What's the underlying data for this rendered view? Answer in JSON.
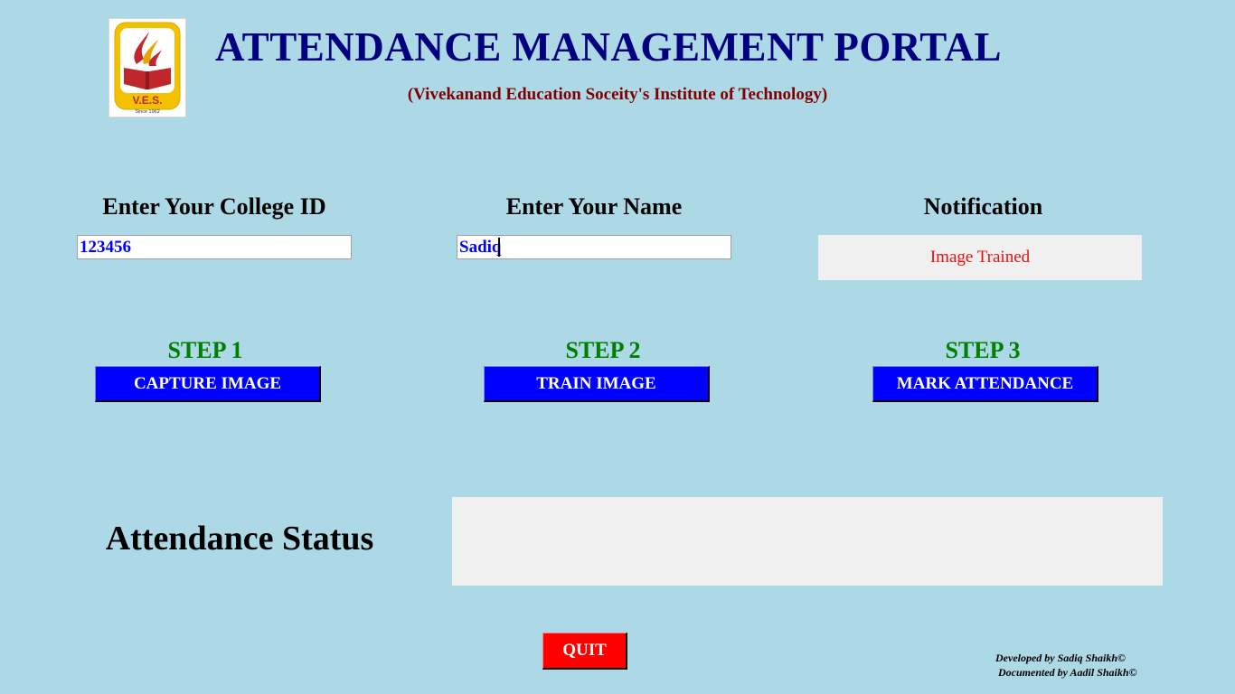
{
  "header": {
    "title": "ATTENDANCE MANAGEMENT PORTAL",
    "subtitle": "(Vivekanand Education Soceity's Institute of Technology)",
    "logo": {
      "icon": "ves-logo",
      "text": "V.E.S.",
      "since": "Since 1962"
    }
  },
  "form": {
    "college_id": {
      "label": "Enter Your College ID",
      "value": "123456"
    },
    "name": {
      "label": "Enter Your Name",
      "value": "Sadiq"
    },
    "notification": {
      "label": "Notification",
      "message": "Image Trained"
    }
  },
  "steps": [
    {
      "label": "STEP 1",
      "button": "CAPTURE IMAGE"
    },
    {
      "label": "STEP 2",
      "button": "TRAIN IMAGE"
    },
    {
      "label": "STEP 3",
      "button": "MARK ATTENDANCE"
    }
  ],
  "attendance": {
    "label": "Attendance Status",
    "value": ""
  },
  "quit_label": "QUIT",
  "credits": {
    "developed": "Developed by Sadiq Shaikh©",
    "documented": "Documented by Aadil Shaikh©"
  },
  "colors": {
    "background": "#add8e6",
    "title": "#000080",
    "subtitle": "#800000",
    "step": "#008000",
    "button": "#0000ff",
    "quit": "#ff0000",
    "notification_text": "#e81010",
    "input_text": "#0000ff"
  }
}
